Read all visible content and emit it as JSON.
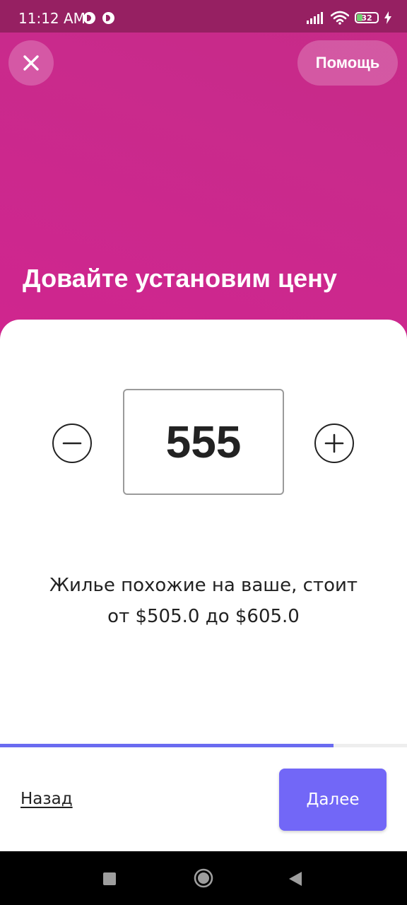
{
  "status_bar": {
    "time": "11:12 AM",
    "battery_level": "32",
    "battery_fraction": 0.32,
    "icons": [
      "app-notification-icon",
      "app-notification-icon",
      "signal-icon",
      "wifi-icon",
      "battery-icon",
      "charging-icon"
    ]
  },
  "header": {
    "close_icon": "close-icon",
    "help_label": "Помощь",
    "title": "Довайте установим цену"
  },
  "price": {
    "value": "555",
    "decrease_icon": "minus-icon",
    "increase_icon": "plus-icon"
  },
  "hint": {
    "line1": "Жилье похожие на ваше, стоит",
    "line2": "от $505.0 до $605.0"
  },
  "progress": {
    "fraction": 0.82
  },
  "footer": {
    "back_label": "Назад",
    "next_label": "Далее"
  },
  "colors": {
    "hero_gradient": [
      "#c62b87",
      "#d0258f"
    ],
    "status_bar": "#962062",
    "accent": "#7267f7",
    "progress": "#6a6bf0",
    "text": "#222222"
  },
  "nav_bar": {
    "icons": [
      "recent-apps-icon",
      "home-icon",
      "back-icon"
    ]
  }
}
